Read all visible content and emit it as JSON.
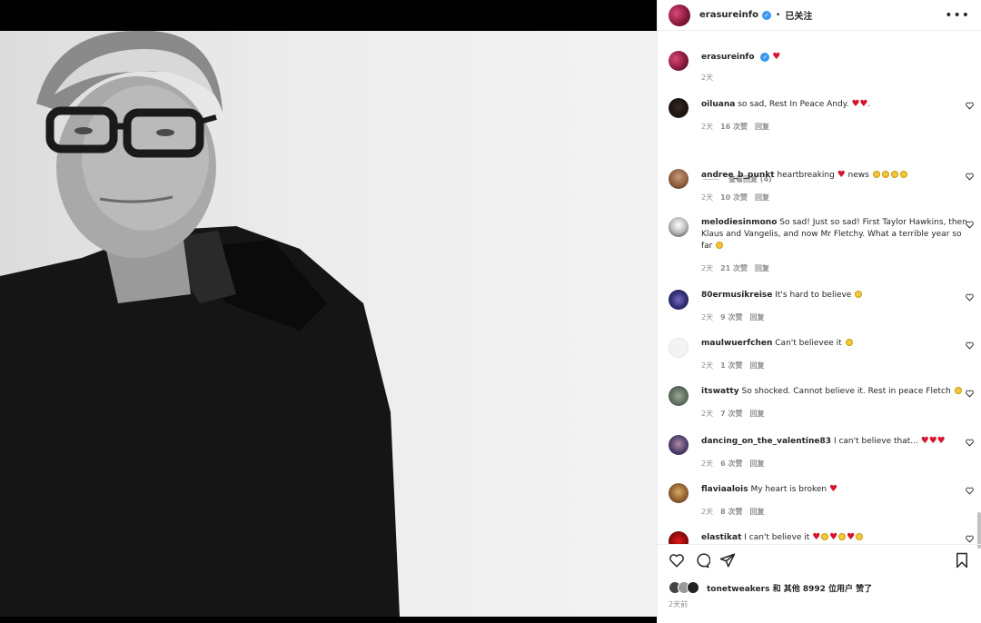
{
  "post": {
    "author": "erasureinfo",
    "follow_status": "已关注",
    "caption_time": "2天",
    "likes_text": "tonetweakers 和 其他 8992 位用户 赞了",
    "posted_ago": "2天前"
  },
  "view_replies": "查看回复 (4)",
  "comments": [
    {
      "user": "oiluana",
      "text": "so sad, Rest In Peace Andy. ",
      "time": "2天",
      "likes": "16 次赞",
      "reply": "回复"
    },
    {
      "user": "andree_b_punkt",
      "text": "heartbreaking ",
      "text2": " news ",
      "time": "2天",
      "likes": "10 次赞",
      "reply": "回复"
    },
    {
      "user": "melodiesinmono",
      "text": "So sad! Just so sad! First Taylor Hawkins, then Klaus and Vangelis, and now Mr Fletchy. What a terrible year so far ",
      "time": "2天",
      "likes": "21 次赞",
      "reply": "回复"
    },
    {
      "user": "80ermusikreise",
      "text": "It's hard to believe ",
      "time": "2天",
      "likes": "9 次赞",
      "reply": "回复"
    },
    {
      "user": "maulwuerfchen",
      "text": "Can't believee it ",
      "time": "2天",
      "likes": "1 次赞",
      "reply": "回复"
    },
    {
      "user": "itswatty",
      "text": "So shocked. Cannot believe it. Rest in peace Fletch ",
      "time": "2天",
      "likes": "7 次赞",
      "reply": "回复"
    },
    {
      "user": "dancing_on_the_valentine83",
      "text": "I can't believe that... ",
      "time": "2天",
      "likes": "6 次赞",
      "reply": "回复"
    },
    {
      "user": "flaviaalois",
      "text": "My heart is broken ",
      "time": "2天",
      "likes": "8 次赞",
      "reply": "回复"
    },
    {
      "user": "elastikat",
      "text": "I can't believe it ",
      "time": "",
      "likes": "",
      "reply": ""
    }
  ],
  "colors": {
    "accent": "#3897f0",
    "heart": "#d4142b"
  },
  "icons": [
    "more-icon",
    "heart-icon",
    "comment-icon",
    "share-icon",
    "bookmark-icon",
    "verified-icon"
  ]
}
